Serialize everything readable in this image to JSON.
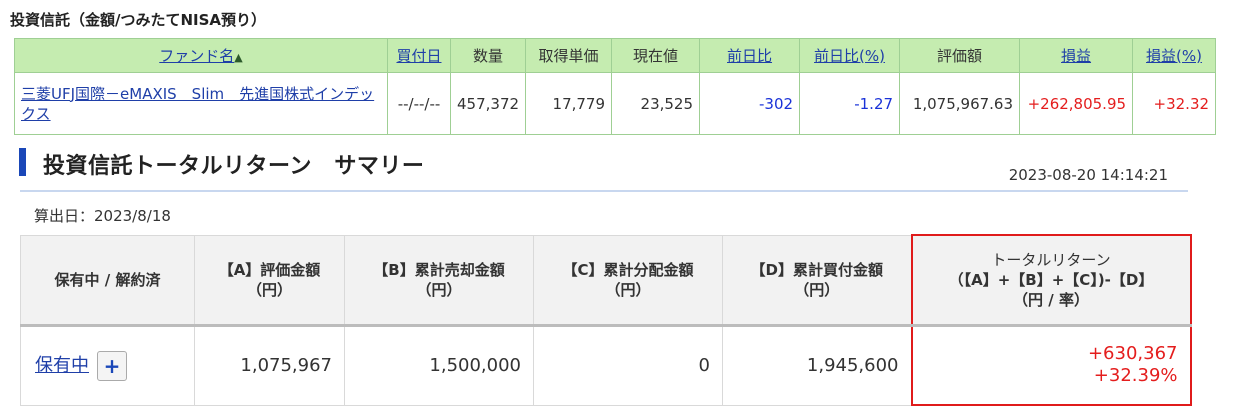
{
  "section_title": "投資信託（金額/つみたてNISA預り）",
  "fund_table": {
    "headers": {
      "fund_name": "ファンド名",
      "buy_date": "買付日",
      "quantity": "数量",
      "avg_price": "取得単価",
      "current_price": "現在値",
      "day_change": "前日比",
      "day_change_pct": "前日比(%)",
      "valuation": "評価額",
      "profit": "損益",
      "profit_pct": "損益(%)"
    },
    "rows": [
      {
        "fund_name": "三菱UFJ国際－eMAXIS　Slim　先進国株式インデックス",
        "buy_date": "--/--/--",
        "quantity": "457,372",
        "avg_price": "17,779",
        "current_price": "23,525",
        "day_change": "-302",
        "day_change_pct": "-1.27",
        "valuation": "1,075,967.63",
        "profit": "+262,805.95",
        "profit_pct": "+32.32"
      }
    ]
  },
  "summary": {
    "title": "投資信託トータルリターン　サマリー",
    "timestamp": "2023-08-20 14:14:21",
    "calc_date": "算出日：2023/8/18",
    "headers": {
      "status": "保有中 / 解約済",
      "a_line1": "【A】評価金額",
      "a_line2": "（円）",
      "b_line1": "【B】累計売却金額",
      "b_line2": "（円）",
      "c_line1": "【C】累計分配金額",
      "c_line2": "（円）",
      "d_line1": "【D】累計買付金額",
      "d_line2": "（円）",
      "total_line1": "トータルリターン",
      "total_line2": "（【A】+【B】+【C】)-【D】",
      "total_line3": "（円 / 率）"
    },
    "row": {
      "status_link": "保有中",
      "expand_button": "+",
      "a": "1,075,967",
      "b": "1,500,000",
      "c": "0",
      "d": "1,945,600",
      "total_yen": "+630,367",
      "total_pct": "+32.39%"
    }
  },
  "colors": {
    "header_green": "#c5ecb0",
    "link_blue": "#1f3fa8",
    "negative_blue": "#1a32d8",
    "positive_red": "#e41d1d",
    "highlight_border": "#e01b1b"
  }
}
